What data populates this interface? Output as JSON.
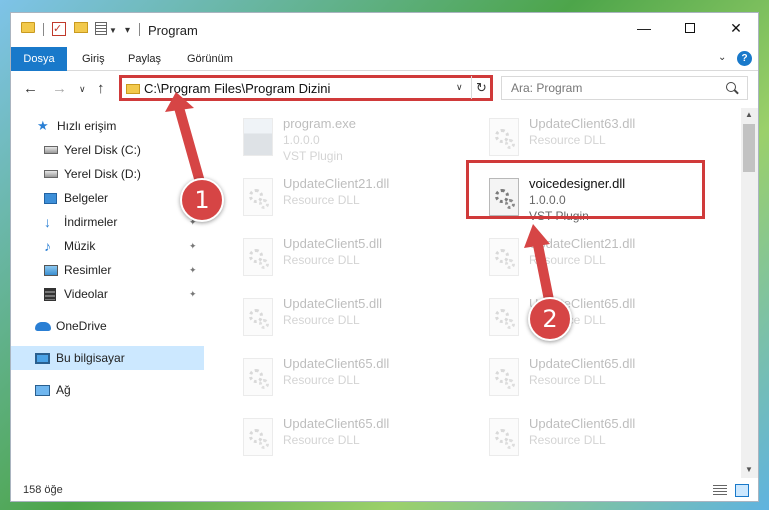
{
  "window": {
    "title": "Program",
    "minimize_glyph": "—",
    "close_glyph": "✕"
  },
  "ribbon": {
    "tabs": [
      "Dosya",
      "Giriş",
      "Paylaş",
      "Görünüm"
    ],
    "help_glyph": "?"
  },
  "navigation": {
    "address": "C:\\Program Files\\Program Dizini",
    "search_placeholder": "Ara: Program"
  },
  "sidebar": {
    "items": [
      {
        "label": "Hızlı erişim",
        "icon": "star-icon"
      },
      {
        "label": "Yerel Disk (C:)",
        "icon": "disk-icon"
      },
      {
        "label": "Yerel Disk (D:)",
        "icon": "disk-icon"
      },
      {
        "label": "Belgeler",
        "icon": "desktop-icon"
      },
      {
        "label": "İndirmeler",
        "icon": "download-icon"
      },
      {
        "label": "Müzik",
        "icon": "music-icon"
      },
      {
        "label": "Resimler",
        "icon": "pictures-icon"
      },
      {
        "label": "Videolar",
        "icon": "video-icon"
      },
      {
        "label": "OneDrive",
        "icon": "cloud-icon"
      },
      {
        "label": "Bu bilgisayar",
        "icon": "computer-icon"
      },
      {
        "label": "Ağ",
        "icon": "network-icon"
      }
    ]
  },
  "files": [
    {
      "name": "program.exe",
      "meta1": "1.0.0.0",
      "meta2": "VST Plugin"
    },
    {
      "name": "UpdateClient63.dll",
      "meta1": "Resource DLL",
      "meta2": ""
    },
    {
      "name": "UpdateClient21.dll",
      "meta1": "Resource DLL",
      "meta2": ""
    },
    {
      "name": "voicedesigner.dll",
      "meta1": "1.0.0.0",
      "meta2": "VST Plugin"
    },
    {
      "name": "UpdateClient5.dll",
      "meta1": "Resource DLL",
      "meta2": ""
    },
    {
      "name": "UpdateClient21.dll",
      "meta1": "Resource DLL",
      "meta2": ""
    },
    {
      "name": "UpdateClient5.dll",
      "meta1": "Resource DLL",
      "meta2": ""
    },
    {
      "name": "UpdateClient65.dll",
      "meta1": "Resource DLL",
      "meta2": ""
    },
    {
      "name": "UpdateClient65.dll",
      "meta1": "Resource DLL",
      "meta2": ""
    },
    {
      "name": "UpdateClient65.dll",
      "meta1": "Resource DLL",
      "meta2": ""
    },
    {
      "name": "UpdateClient65.dll",
      "meta1": "Resource DLL",
      "meta2": ""
    },
    {
      "name": "UpdateClient65.dll",
      "meta1": "Resource DLL",
      "meta2": ""
    }
  ],
  "status": {
    "item_count": "158 öğe"
  },
  "annotations": {
    "step1": "1",
    "step2": "2",
    "color": "#d64545"
  }
}
